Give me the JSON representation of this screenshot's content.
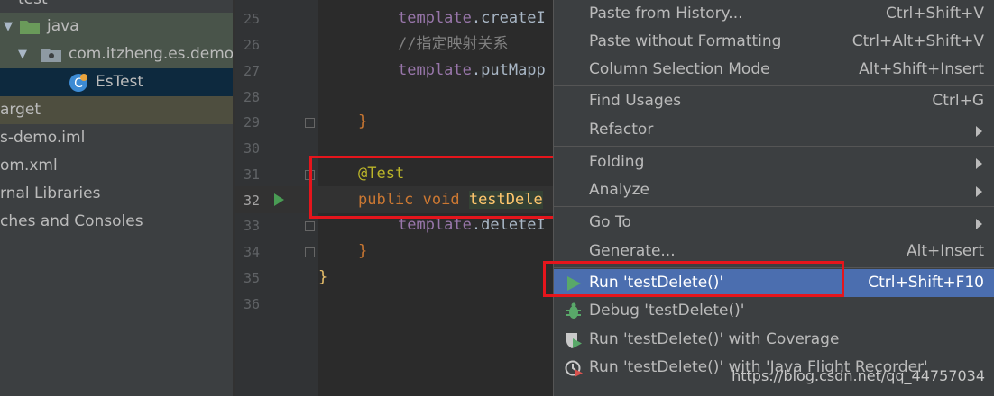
{
  "sidebar": {
    "items": [
      {
        "label": "test"
      },
      {
        "label": "java"
      },
      {
        "label": "com.itzheng.es.demo"
      },
      {
        "label": "EsTest"
      },
      {
        "label": "arget"
      },
      {
        "label": "s-demo.iml"
      },
      {
        "label": "om.xml"
      },
      {
        "label": "rnal Libraries"
      },
      {
        "label": "ches and Consoles"
      }
    ]
  },
  "editor": {
    "line_numbers": [
      "25",
      "26",
      "27",
      "28",
      "29",
      "30",
      "31",
      "32",
      "33",
      "34",
      "35",
      "36"
    ],
    "lines": {
      "l25": {
        "a": "template",
        "b": ".createI"
      },
      "l26": "//指定映射关系",
      "l27": {
        "a": "template",
        "b": ".putMapp"
      },
      "l29": "}",
      "l31": "@Test",
      "l32": {
        "kw": "public void ",
        "fn": "testDele"
      },
      "l33": {
        "a": "template",
        "b": ".deleteI"
      },
      "l34": "}",
      "l35": "}"
    }
  },
  "menu": {
    "items": [
      {
        "label": "Paste from History...",
        "shortcut": "Ctrl+Shift+V"
      },
      {
        "label": "Paste without Formatting",
        "shortcut": "Ctrl+Alt+Shift+V"
      },
      {
        "label": "Column Selection Mode",
        "shortcut": "Alt+Shift+Insert"
      },
      {
        "label": "Find Usages",
        "shortcut": "Ctrl+G"
      },
      {
        "label": "Refactor",
        "shortcut": ""
      },
      {
        "label": "Folding",
        "shortcut": ""
      },
      {
        "label": "Analyze",
        "shortcut": ""
      },
      {
        "label": "Go To",
        "shortcut": ""
      },
      {
        "label": "Generate...",
        "shortcut": "Alt+Insert"
      },
      {
        "label": "Run 'testDelete()'",
        "shortcut": "Ctrl+Shift+F10"
      },
      {
        "label": "Debug 'testDelete()'",
        "shortcut": ""
      },
      {
        "label": "Run 'testDelete()' with Coverage",
        "shortcut": ""
      },
      {
        "label": "Run 'testDelete()' with 'Java Flight Recorder'",
        "shortcut": ""
      }
    ]
  },
  "watermark": "https://blog.csdn.net/qq_44757034",
  "colors": {
    "menu_selected": "#4b6eaf",
    "annotation_box": "#e5151c",
    "run_green": "#499c54"
  }
}
